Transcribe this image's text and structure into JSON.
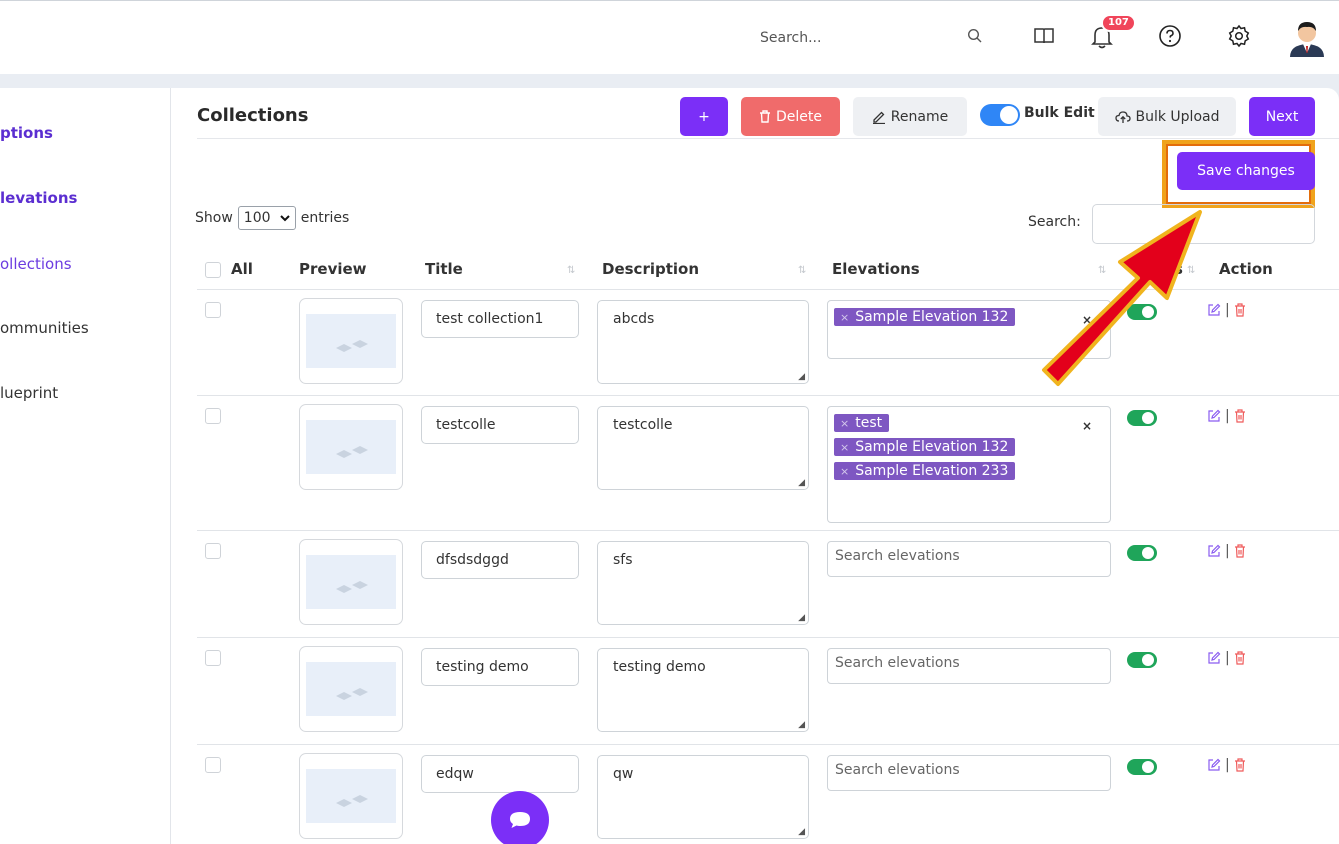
{
  "topbar": {
    "search_placeholder": "Search...",
    "notification_count": "107",
    "icons": [
      "search-icon",
      "book-icon",
      "bell-icon",
      "help-icon",
      "gear-icon",
      "user-avatar"
    ]
  },
  "sidebar": {
    "items": [
      {
        "label": "ptions"
      },
      {
        "label": "levations"
      },
      {
        "label": "ollections"
      },
      {
        "label": "ommunities"
      },
      {
        "label": "lueprint"
      }
    ]
  },
  "main": {
    "title": "Collections",
    "toolbar": {
      "add_label": "+",
      "delete_label": "Delete",
      "rename_label": "Rename",
      "bulk_edit_label": "Bulk Edit",
      "bulk_upload_label": "Bulk Upload",
      "next_label": "Next",
      "save_label": "Save changes"
    },
    "show": {
      "prefix": "Show",
      "value": "100",
      "suffix": "entries"
    },
    "search_label": "Search:",
    "columns": {
      "all": "All",
      "preview": "Preview",
      "title": "Title",
      "description": "Description",
      "elevations": "Elevations",
      "status": "s",
      "action": "Action"
    },
    "elevation_placeholder": "Search elevations",
    "rows": [
      {
        "title": "test collection1",
        "description": "abcds",
        "elevations": [
          "Sample Elevation 132"
        ]
      },
      {
        "title": "testcolle",
        "description": "testcolle",
        "elevations": [
          "test",
          "Sample Elevation 132",
          "Sample Elevation 233"
        ]
      },
      {
        "title": "dfsdsdggd",
        "description": "sfs",
        "elevations": []
      },
      {
        "title": "testing demo",
        "description": "testing demo",
        "elevations": []
      },
      {
        "title": "edqw",
        "description": "qw",
        "elevations": []
      }
    ]
  },
  "colors": {
    "primary": "#7b2ff7",
    "danger": "#f06b6b",
    "toggle_on": "#1fa55a",
    "chip": "#7e57c2",
    "highlight": "#f0a31c",
    "arrow": "#e3001b"
  }
}
